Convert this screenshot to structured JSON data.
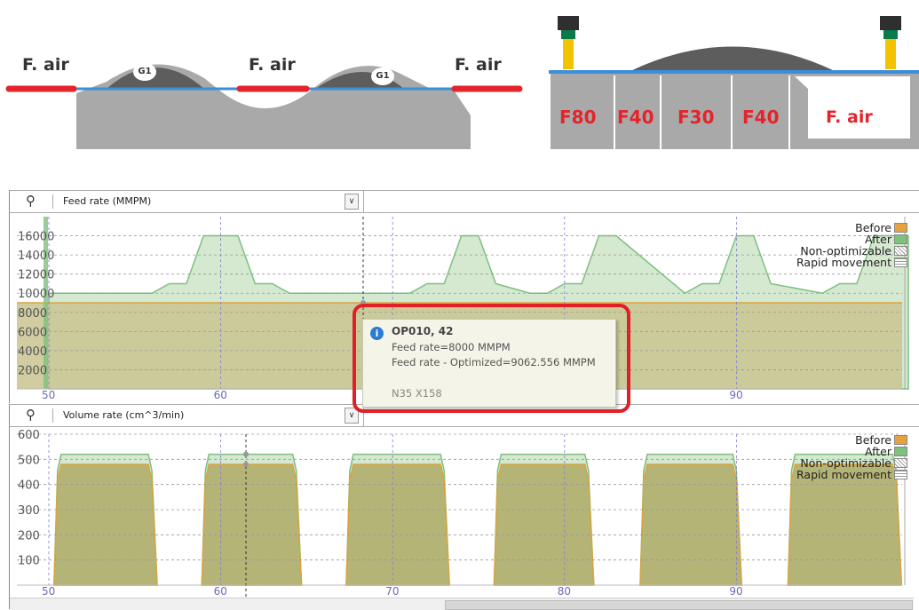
{
  "diagram_left": {
    "labels": [
      "F. air",
      "F. air",
      "F. air"
    ],
    "g1_labels": [
      "G1",
      "G1"
    ]
  },
  "diagram_right": {
    "segments": [
      "F80",
      "F40",
      "F30",
      "F40"
    ],
    "air_label": "F. air"
  },
  "colors": {
    "red": "#e4242b",
    "blue_line": "#3a8fd8",
    "gray_stock": "#a9a9a9",
    "dark_gray": "#5d5d5d",
    "before": "#e6a23c",
    "after": "#7ec07e",
    "before_fill": "#c9c490",
    "after_fill": "#d5e8d0"
  },
  "feed_panel": {
    "title": "Feed rate (MMPM)",
    "y_ticks": [
      "16000",
      "14000",
      "12000",
      "10000",
      "8000",
      "6000",
      "4000",
      "2000"
    ],
    "x_ticks": [
      "50",
      "60",
      "70",
      "80",
      "90"
    ],
    "legend": {
      "before": "Before",
      "after": "After",
      "non_opt": "Non-optimizable",
      "rapid": "Rapid movement"
    },
    "tooltip": {
      "title": "OP010, 42",
      "feed": "Feed rate=8000 MMPM",
      "feed_opt": "Feed rate - Optimized=9062.556 MMPM",
      "block": "N35 X158"
    }
  },
  "volume_panel": {
    "title": "Volume rate (cm^3/min)",
    "y_ticks": [
      "600",
      "500",
      "400",
      "300",
      "200",
      "100"
    ],
    "x_ticks": [
      "50",
      "60",
      "70",
      "80",
      "90"
    ],
    "legend": {
      "before": "Before",
      "after": "After",
      "non_opt": "Non-optimizable",
      "rapid": "Rapid movement"
    }
  },
  "chart_data": [
    {
      "type": "area",
      "title": "Feed rate (MMPM)",
      "xlim": [
        50,
        100
      ],
      "ylim": [
        0,
        18000
      ],
      "series": [
        {
          "name": "Before",
          "x": [
            50,
            100
          ],
          "values": [
            9000,
            9000
          ]
        },
        {
          "name": "After",
          "x": [
            50,
            56,
            57,
            58,
            59,
            61,
            62,
            63,
            64,
            65,
            66,
            71,
            72,
            73,
            74,
            75,
            76,
            78,
            79,
            80,
            81,
            82,
            83,
            87,
            88,
            89,
            90,
            91,
            92,
            95,
            96,
            97,
            98,
            100
          ],
          "values": [
            10000,
            10000,
            11000,
            11000,
            16000,
            16000,
            11000,
            11000,
            10000,
            10000,
            10000,
            10000,
            11000,
            11000,
            16000,
            16000,
            11000,
            10000,
            10000,
            11000,
            11000,
            16000,
            16000,
            10000,
            11000,
            11000,
            16000,
            16000,
            11000,
            10000,
            11000,
            11000,
            16000,
            16000
          ]
        }
      ]
    },
    {
      "type": "area",
      "title": "Volume rate (cm^3/min)",
      "xlim": [
        50,
        100
      ],
      "ylim": [
        0,
        600
      ],
      "series": [
        {
          "name": "Before",
          "blocks": [
            [
              50.3,
              56.2
            ],
            [
              58.9,
              64.6
            ],
            [
              67.3,
              73.2
            ],
            [
              75.9,
              81.6
            ],
            [
              84.4,
              90.2
            ],
            [
              93,
              99.5
            ]
          ],
          "value": 480
        },
        {
          "name": "After",
          "blocks": [
            [
              50.3,
              56.2
            ],
            [
              58.9,
              64.6
            ],
            [
              67.3,
              73.2
            ],
            [
              75.9,
              81.6
            ],
            [
              84.4,
              90.2
            ],
            [
              93,
              99.5
            ]
          ],
          "value": 520
        }
      ]
    }
  ]
}
